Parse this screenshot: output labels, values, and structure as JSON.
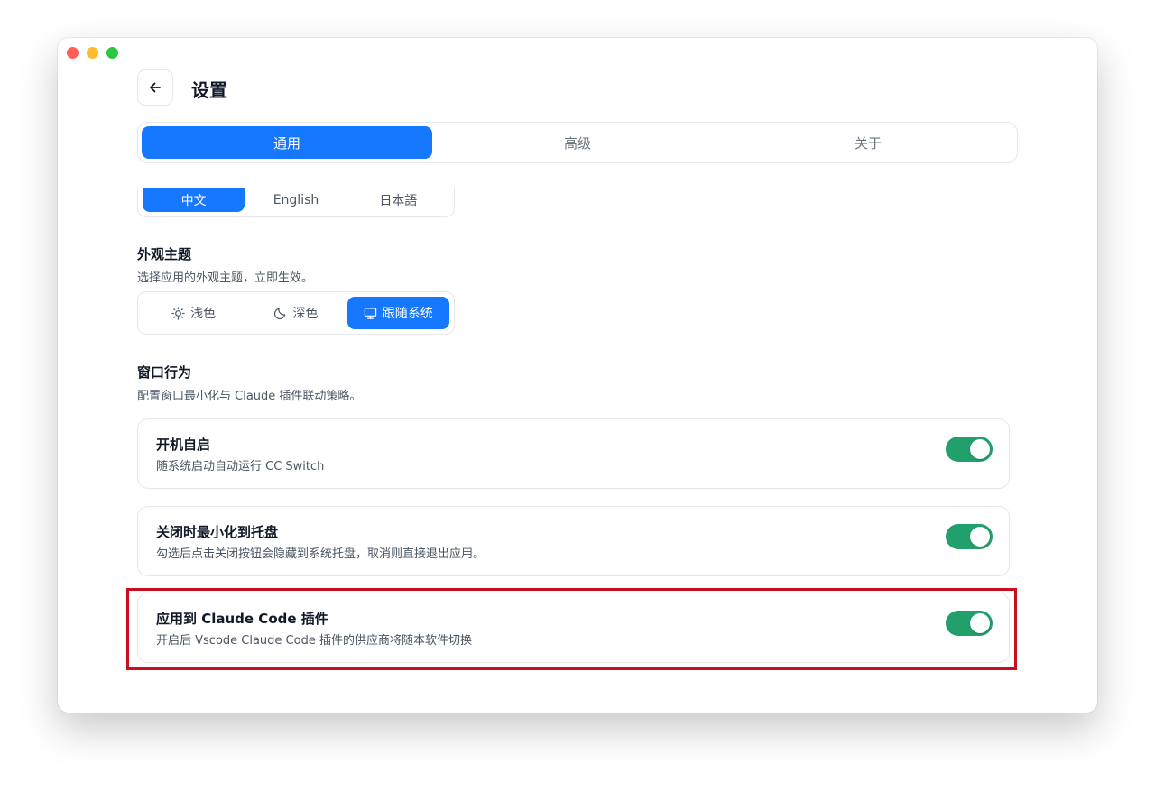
{
  "header": {
    "title": "设置"
  },
  "tabs": [
    {
      "label": "通用",
      "active": true
    },
    {
      "label": "高级",
      "active": false
    },
    {
      "label": "关于",
      "active": false
    }
  ],
  "language": {
    "options": [
      {
        "label": "中文",
        "active": true
      },
      {
        "label": "English",
        "active": false
      },
      {
        "label": "日本語",
        "active": false
      }
    ]
  },
  "theme": {
    "title": "外观主题",
    "description": "选择应用的外观主题，立即生效。",
    "options": [
      {
        "label": "浅色",
        "icon": "sun-icon",
        "active": false
      },
      {
        "label": "深色",
        "icon": "moon-icon",
        "active": false
      },
      {
        "label": "跟随系统",
        "icon": "monitor-icon",
        "active": true
      }
    ]
  },
  "window_behavior": {
    "title": "窗口行为",
    "description": "配置窗口最小化与 Claude 插件联动策略。",
    "items": [
      {
        "title": "开机自启",
        "description": "随系统启动自动运行 CC Switch",
        "enabled": true
      },
      {
        "title": "关闭时最小化到托盘",
        "description": "勾选后点击关闭按钮会隐藏到系统托盘，取消则直接退出应用。",
        "enabled": true
      },
      {
        "title": "应用到 Claude Code 插件",
        "description": "开启后 Vscode Claude Code 插件的供应商将随本软件切换",
        "enabled": true
      }
    ]
  },
  "colors": {
    "accent": "#1677ff",
    "toggle_on": "#22a06b",
    "highlight": "#c8101c"
  }
}
